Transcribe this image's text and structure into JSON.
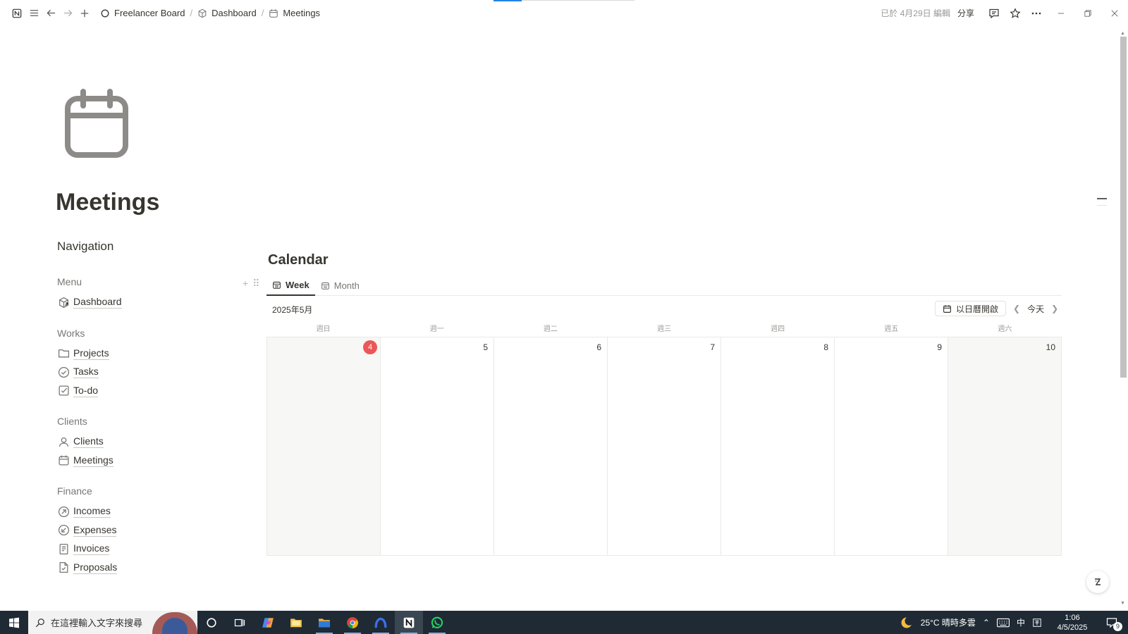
{
  "topbar": {
    "breadcrumbs": [
      "Freelancer Board",
      "Dashboard",
      "Meetings"
    ],
    "edited": "已於 4月29日 編輯",
    "share": "分享"
  },
  "page": {
    "title": "Meetings"
  },
  "navigation": {
    "title": "Navigation",
    "groups": [
      {
        "label": "Menu",
        "items": [
          {
            "label": "Dashboard",
            "icon": "cube-icon"
          }
        ]
      },
      {
        "label": "Works",
        "items": [
          {
            "label": "Projects",
            "icon": "folder-icon"
          },
          {
            "label": "Tasks",
            "icon": "check-circle-icon"
          },
          {
            "label": "To-do",
            "icon": "checkbox-icon"
          }
        ]
      },
      {
        "label": "Clients",
        "items": [
          {
            "label": "Clients",
            "icon": "person-icon"
          },
          {
            "label": "Meetings",
            "icon": "calendar-icon"
          }
        ]
      },
      {
        "label": "Finance",
        "items": [
          {
            "label": "Incomes",
            "icon": "arrow-up-circle-icon"
          },
          {
            "label": "Expenses",
            "icon": "arrow-down-circle-icon"
          },
          {
            "label": "Invoices",
            "icon": "document-icon"
          },
          {
            "label": "Proposals",
            "icon": "file-check-icon"
          }
        ]
      }
    ]
  },
  "calendar": {
    "heading": "Calendar",
    "views": [
      {
        "label": "Week",
        "active": true
      },
      {
        "label": "Month",
        "active": false
      }
    ],
    "month": "2025年5月",
    "open_in_calendar": "以日曆開啟",
    "today": "今天",
    "weekdays": [
      "週日",
      "週一",
      "週二",
      "週三",
      "週四",
      "週五",
      "週六"
    ],
    "days": [
      "4",
      "5",
      "6",
      "7",
      "8",
      "9",
      "10"
    ],
    "today_index": 0,
    "today_color": "#eb5757"
  },
  "taskbar": {
    "search_placeholder": "在這裡輸入文字來搜尋",
    "weather": "25°C 晴時多雲",
    "ime": "中",
    "time": "1:06",
    "date": "4/5/2025",
    "notifications": "9"
  }
}
